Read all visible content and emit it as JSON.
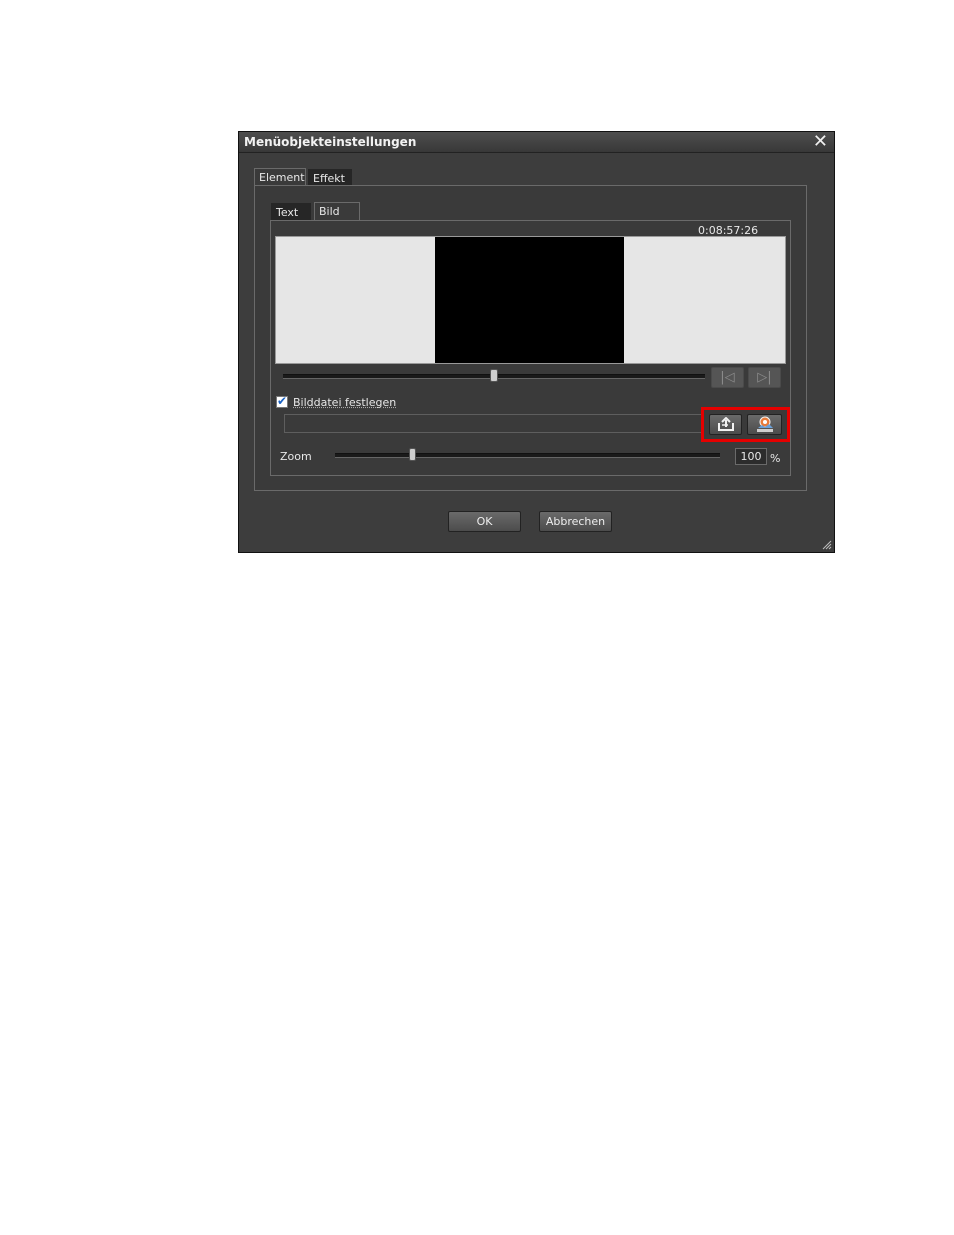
{
  "dialog": {
    "title": "Menüobjekteinstellungen",
    "close_glyph": "✕"
  },
  "tabs": {
    "outer": [
      "Element",
      "Effekt"
    ],
    "inner": [
      "Text",
      "Bild"
    ]
  },
  "preview": {
    "timecode": "0:08:57:26",
    "position_fraction": 0.5
  },
  "nav": {
    "prev_glyph": "|◁",
    "next_glyph": "▷|"
  },
  "image_file": {
    "checkbox_label": "Bilddatei festlegen",
    "checked": true,
    "path_value": ""
  },
  "zoom": {
    "label": "Zoom",
    "value": "100",
    "unit": "%",
    "level_fraction": 0.2
  },
  "footer": {
    "ok_label": "OK",
    "cancel_label": "Abbrechen"
  },
  "icons": {
    "load": "load-image-icon",
    "from_clip": "image-from-clip-icon",
    "close": "close-icon"
  },
  "colors": {
    "highlight": "#e50000",
    "dialog_bg": "#3d3d3d"
  }
}
